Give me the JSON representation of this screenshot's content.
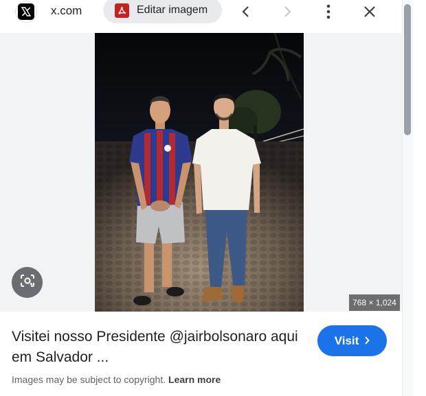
{
  "toolbar": {
    "site_name": "x.com",
    "site_icon": "x-logo-icon",
    "edit_label": "Editar imagem",
    "edit_icon": "pdf-icon",
    "back_icon": "chevron-left-icon",
    "forward_icon": "chevron-right-icon",
    "more_icon": "more-vert-icon",
    "close_icon": "close-icon"
  },
  "preview": {
    "dimensions": "768 × 1,024",
    "lens_icon": "google-lens-icon"
  },
  "caption": {
    "text": "Visitei nosso Presidente @jairbolsonaro aqui em Salvador ..."
  },
  "visit_button": {
    "label": "Visit",
    "icon": "chevron-right-icon",
    "color": "#1a73e8"
  },
  "copyright": {
    "notice": "Images may be subject to copyright.",
    "link": "Learn more"
  }
}
